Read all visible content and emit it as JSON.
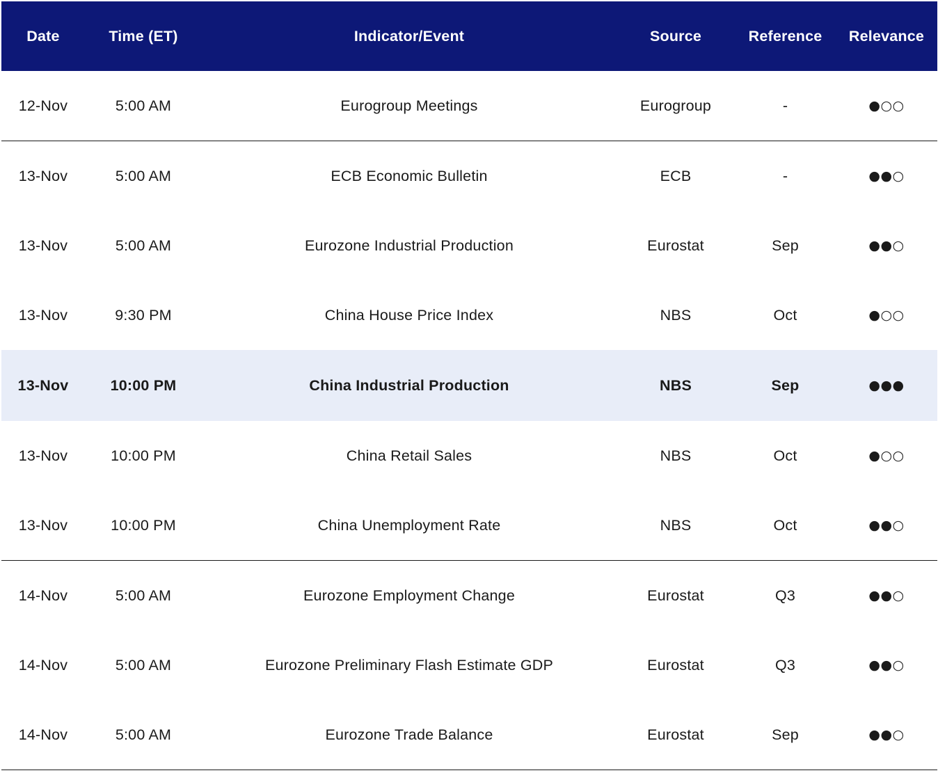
{
  "columns": {
    "date": "Date",
    "time": "Time (ET)",
    "event": "Indicator/Event",
    "source": "Source",
    "reference": "Reference",
    "relevance": "Relevance"
  },
  "rows": [
    {
      "date": "12-Nov",
      "time": "5:00 AM",
      "event": "Eurogroup Meetings",
      "source": "Eurogroup",
      "reference": "-",
      "relevance": "●○○"
    },
    {
      "date": "13-Nov",
      "time": "5:00 AM",
      "event": "ECB Economic Bulletin",
      "source": "ECB",
      "reference": "-",
      "relevance": "●●○"
    },
    {
      "date": "13-Nov",
      "time": "5:00 AM",
      "event": "Eurozone Industrial Production",
      "source": "Eurostat",
      "reference": "Sep",
      "relevance": "●●○"
    },
    {
      "date": "13-Nov",
      "time": "9:30 PM",
      "event": "China House Price Index",
      "source": "NBS",
      "reference": "Oct",
      "relevance": "●○○"
    },
    {
      "date": "13-Nov",
      "time": "10:00 PM",
      "event": "China Industrial Production",
      "source": "NBS",
      "reference": "Sep",
      "relevance": "●●●"
    },
    {
      "date": "13-Nov",
      "time": "10:00 PM",
      "event": "China Retail Sales",
      "source": "NBS",
      "reference": "Oct",
      "relevance": "●○○"
    },
    {
      "date": "13-Nov",
      "time": "10:00 PM",
      "event": "China Unemployment Rate",
      "source": "NBS",
      "reference": "Oct",
      "relevance": "●●○"
    },
    {
      "date": "14-Nov",
      "time": "5:00 AM",
      "event": "Eurozone Employment Change",
      "source": "Eurostat",
      "reference": "Q3",
      "relevance": "●●○"
    },
    {
      "date": "14-Nov",
      "time": "5:00 AM",
      "event": "Eurozone Preliminary Flash Estimate GDP",
      "source": "Eurostat",
      "reference": "Q3",
      "relevance": "●●○"
    },
    {
      "date": "14-Nov",
      "time": "5:00 AM",
      "event": "Eurozone Trade Balance",
      "source": "Eurostat",
      "reference": "Sep",
      "relevance": "●●○"
    }
  ],
  "colors": {
    "header_bg": "#0d1877",
    "header_text": "#ffffff",
    "highlight_bg": "#e8edf8"
  }
}
